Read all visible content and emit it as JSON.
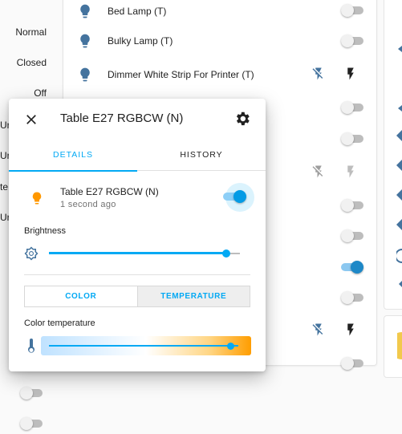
{
  "background": {
    "left_states": [
      "Normal",
      "Closed",
      "Off"
    ],
    "left_cut": [
      "Ur",
      "Ur",
      "te",
      "Ur"
    ],
    "rows": [
      {
        "label": "Bed Lamp (T)"
      },
      {
        "label": "Bulky Lamp (T)"
      },
      {
        "label": "Dimmer White Strip For Printer (T)"
      }
    ]
  },
  "dialog": {
    "title": "Table E27 RGBCW (N)",
    "tabs": [
      {
        "label": "DETAILS",
        "active": true
      },
      {
        "label": "HISTORY",
        "active": false
      }
    ],
    "entity": {
      "name": "Table E27 RGBCW (N)",
      "last_changed": "1 second ago",
      "state": "on"
    },
    "brightness": {
      "label": "Brightness",
      "value_fraction": 0.93
    },
    "mode_tabs": [
      {
        "label": "COLOR",
        "selected": false
      },
      {
        "label": "TEMPERATURE",
        "selected": true
      }
    ],
    "color_temperature": {
      "label": "Color temperature",
      "value_fraction": 0.96
    }
  },
  "colors": {
    "accent": "#03a9f4",
    "bulb_on": "#ff9800",
    "bulb_off": "#44739e"
  }
}
